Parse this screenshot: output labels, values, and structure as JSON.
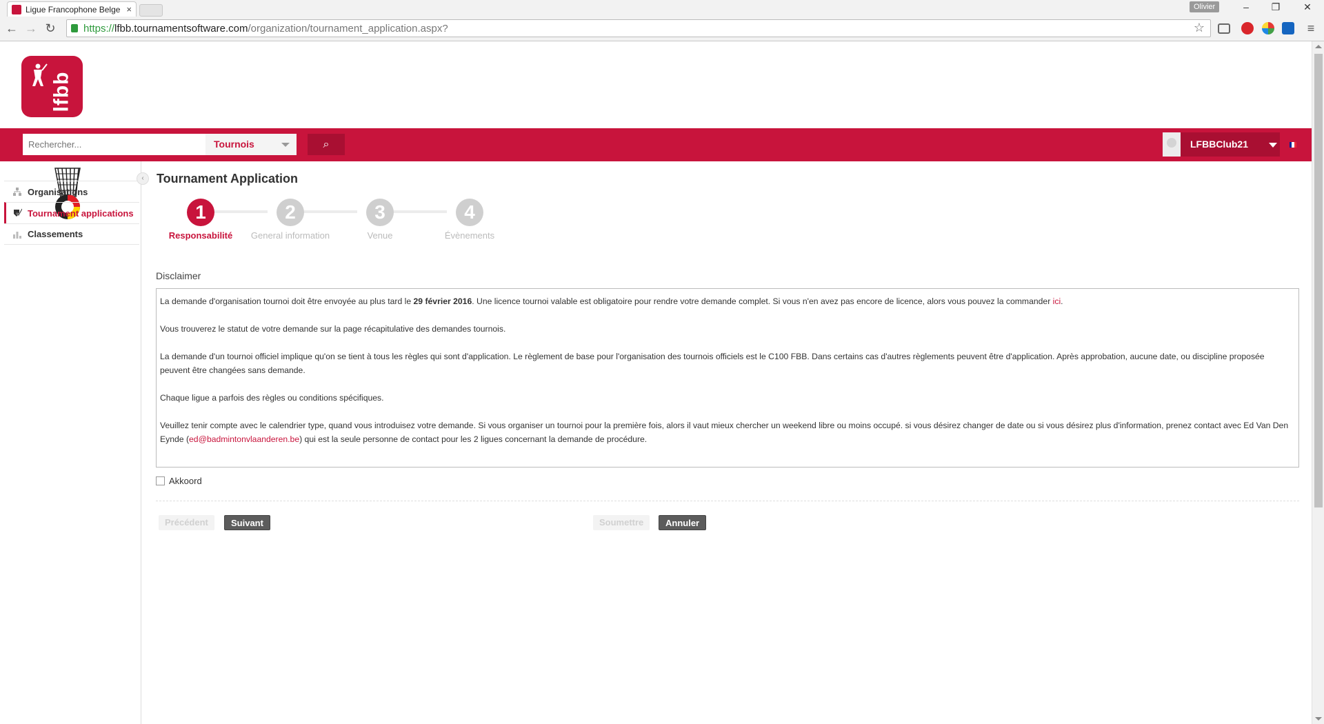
{
  "browser": {
    "tab_title": "Ligue Francophone Belge",
    "tab_close": "×",
    "profile_name": "Olivier",
    "url_protocol": "https://",
    "url_host": "lfbb.tournamentsoftware.com",
    "url_path": "/organization/tournament_application.aspx?",
    "icons": [
      "back-icon",
      "forward-icon",
      "reload-icon",
      "lock-icon",
      "star-icon",
      "cast-icon",
      "menu-icon"
    ]
  },
  "site": {
    "logo_text": "lfbb",
    "search_placeholder": "Rechercher...",
    "search_scope": "Tournois",
    "search_icon": "⌕",
    "user_name": "LFBBClub21",
    "brand_color": "#c8143c"
  },
  "sidebar": {
    "items": [
      {
        "label": "Organisations",
        "icon": "org-chart-icon"
      },
      {
        "label": "Tournament applications",
        "icon": "shield-check-icon"
      },
      {
        "label": "Classements",
        "icon": "ranking-icon"
      }
    ],
    "collapse_glyph": "‹"
  },
  "main": {
    "title": "Tournament Application",
    "steps": [
      {
        "number": "1",
        "label": "Responsabilité",
        "active": true
      },
      {
        "number": "2",
        "label": "General information",
        "active": false
      },
      {
        "number": "3",
        "label": "Venue",
        "active": false
      },
      {
        "number": "4",
        "label": "Évènements",
        "active": false
      }
    ],
    "disclaimer_label": "Disclaimer",
    "disclaimer": {
      "p1_a": "La demande d'organisation tournoi doit être envoyée au plus tard le ",
      "p1_date": "29 février 2016",
      "p1_b": ". Une licence tournoi valable est obligatoire pour rendre votre demande complet. Si vous n'en avez pas encore de licence, alors vous pouvez la commander ",
      "p1_link": "ici",
      "p1_c": ".",
      "p2": "Vous trouverez le statut de votre demande sur la page récapitulative des demandes tournois.",
      "p3": "La demande d'un tournoi officiel implique qu'on se tient à tous les règles qui sont d'application. Le règlement de base pour l'organisation des tournois officiels est le C100 FBB. Dans certains cas d'autres règlements peuvent être d'application. Après approbation, aucune date, ou discipline proposée peuvent être changées sans demande.",
      "p4": "Chaque ligue a parfois des règles ou conditions spécifiques.",
      "p5_a": "Veuillez tenir compte avec le calendrier type, quand vous introduisez votre demande. Si vous organiser un tournoi pour la première fois, alors il vaut mieux chercher un weekend libre ou moins occupé. si vous désirez changer de date ou si vous désirez plus d'information, prenez contact avec Ed Van Den Eynde (",
      "p5_email": "ed@badmintonvlaanderen.be",
      "p5_b": ") qui est la seule personne de contact pour les 2 ligues concernant la demande de procédure."
    },
    "agree_label": "Akkoord",
    "agree_checked": false,
    "buttons": {
      "previous": "Précédent",
      "next": "Suivant",
      "submit": "Soumettre",
      "cancel": "Annuler"
    }
  }
}
